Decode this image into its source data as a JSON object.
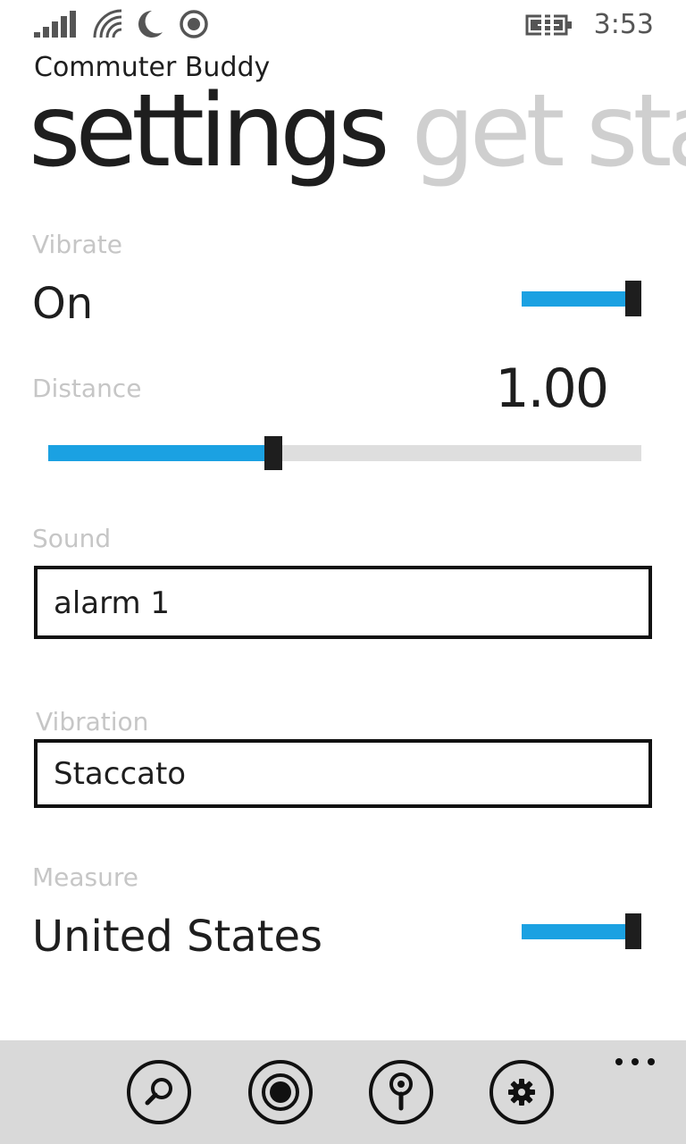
{
  "status_bar": {
    "time": "3:53",
    "icons": [
      "signal-icon",
      "wifi-icon",
      "quiet-hours-icon",
      "location-icon",
      "battery-charging-icon"
    ]
  },
  "app": {
    "title": "Commuter Buddy"
  },
  "pivot": {
    "active": "settings",
    "next": "get sta"
  },
  "settings": {
    "vibrate": {
      "label": "Vibrate",
      "value": "On",
      "toggle_on": true
    },
    "distance": {
      "label": "Distance",
      "value": "1.00",
      "slider_fraction": 0.38
    },
    "sound": {
      "label": "Sound",
      "value": "alarm 1"
    },
    "vibration": {
      "label": "Vibration",
      "value": "Staccato"
    },
    "measure": {
      "label": "Measure",
      "value": "United States",
      "toggle_on": true
    }
  },
  "app_bar": {
    "buttons": [
      "search-icon",
      "record-icon",
      "map-pin-icon",
      "settings-gear-icon"
    ],
    "more": "..."
  },
  "colors": {
    "accent": "#1ba1e2",
    "foreground": "#1e1e1e",
    "label": "#c6c6c6",
    "app_bar": "#d9d9d9"
  }
}
